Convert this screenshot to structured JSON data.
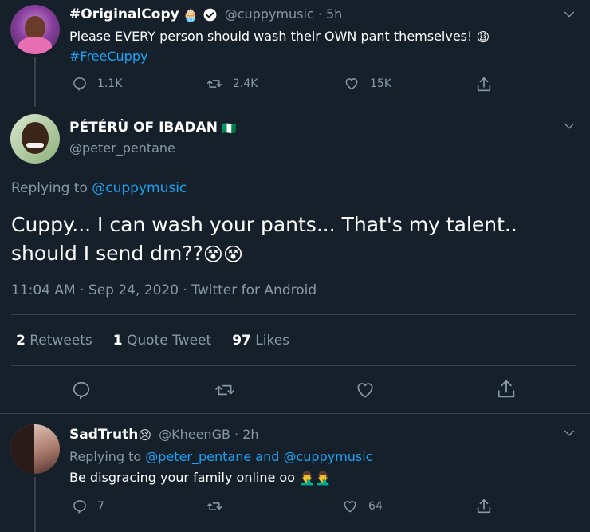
{
  "tweet1": {
    "name": "#OriginalCopy",
    "name_emoji": "🧁",
    "handle": "@cuppymusic",
    "time": "· 5h",
    "text": "Please EVERY person should wash their OWN pant themselves!",
    "text_emoji": "😩",
    "hashtag": "#FreeCuppy",
    "reply_count": "1.1K",
    "retweet_count": "2.4K",
    "like_count": "15K"
  },
  "main": {
    "name": "PÉTÉRÙ OF IBADAN",
    "flag": "🇳🇬",
    "handle": "@peter_pentane",
    "replying_prefix": "Replying to",
    "replying_to": "@cuppymusic",
    "text_line1": "Cuppy... I can wash your pants... That's my talent..",
    "text_line2": "should I send dm??",
    "text_emojis": "😵😵",
    "timestamp": "11:04 AM · Sep 24, 2020 · Twitter for Android",
    "retweets_num": "2",
    "retweets_label": "Retweets",
    "quotes_num": "1",
    "quotes_label": "Quote Tweet",
    "likes_num": "97",
    "likes_label": "Likes"
  },
  "tweet3": {
    "name": "SadTruth",
    "name_emoji": "😢",
    "handle": "@KheenGB",
    "time": "· 2h",
    "replying_prefix": "Replying to",
    "replying_to": "@peter_pentane and @cuppymusic",
    "text": "Be disgracing your family online oo",
    "text_emojis": "🤦‍♂️🤦‍♂️",
    "reply_count": "7",
    "like_count": "64"
  },
  "colors": {
    "background": "#15202b",
    "accent": "#1da1f2",
    "muted": "#8899a6",
    "divider": "#38444d"
  }
}
